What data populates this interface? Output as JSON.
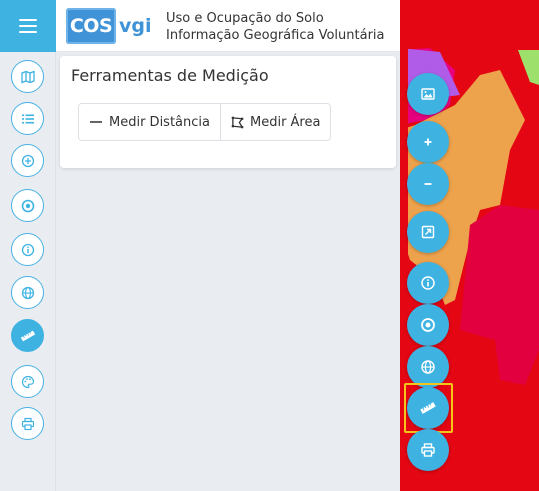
{
  "header": {
    "logo": {
      "part1": "COS",
      "part2": "vgi"
    },
    "title_line1": "Uso e Ocupação do Solo",
    "title_line2": "Informação Geográfica Voluntária"
  },
  "left_toolbar": {
    "items": [
      {
        "icon": "map-icon"
      },
      {
        "icon": "list-icon"
      },
      {
        "icon": "plus-circle-icon"
      },
      {
        "icon": "target-icon"
      },
      {
        "icon": "info-icon"
      },
      {
        "icon": "globe-icon"
      },
      {
        "icon": "ruler-icon",
        "active": true
      },
      {
        "icon": "palette-icon"
      },
      {
        "icon": "print-icon"
      }
    ]
  },
  "panel": {
    "title": "Ferramentas de Medição",
    "buttons": [
      {
        "label": "Medir Distância",
        "icon": "line-icon"
      },
      {
        "label": "Medir Área",
        "icon": "polygon-icon"
      }
    ]
  },
  "map_controls": [
    {
      "icon": "image-icon"
    },
    {
      "icon": "zoom-in-icon"
    },
    {
      "icon": "zoom-out-icon"
    },
    {
      "icon": "zoom-extent-icon"
    },
    {
      "icon": "info-icon"
    },
    {
      "icon": "target-icon"
    },
    {
      "icon": "globe-icon"
    },
    {
      "icon": "ruler-icon",
      "highlighted": true
    },
    {
      "icon": "print-icon"
    }
  ],
  "colors": {
    "accent": "#3eb3e2",
    "logo": "#3f93d6",
    "highlight": "#f5c518",
    "map_red": "#e40613",
    "map_orange": "#eda24c",
    "map_magenta": "#e7007e",
    "map_purple": "#b05ce8",
    "map_green": "#9ee06c"
  }
}
